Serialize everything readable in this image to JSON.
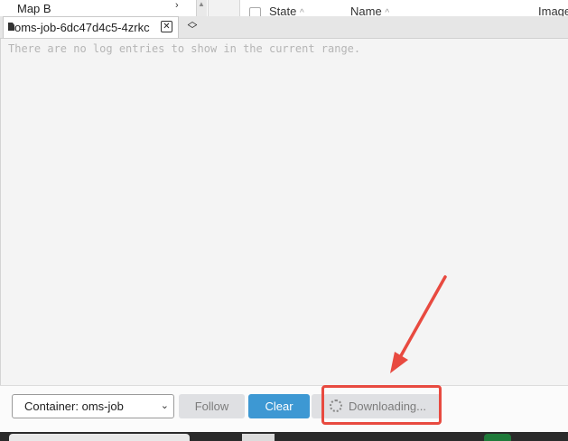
{
  "background": {
    "sidebar_item": "Map B",
    "table_headers": [
      "State",
      "Name",
      "Image"
    ]
  },
  "tab": {
    "title": "oms-job-6dc47d4c5-4zrkc",
    "close_label": "⊠",
    "toggle_label": "⌃⌄"
  },
  "log": {
    "empty_message": "There are no log entries to show in the current range."
  },
  "footer": {
    "container_select": "Container: oms-job",
    "follow_label": "Follow",
    "clear_label": "Clear",
    "download_label": "Downloading..."
  },
  "colors": {
    "accent": "#3d98d3",
    "highlight": "#e84a40"
  }
}
